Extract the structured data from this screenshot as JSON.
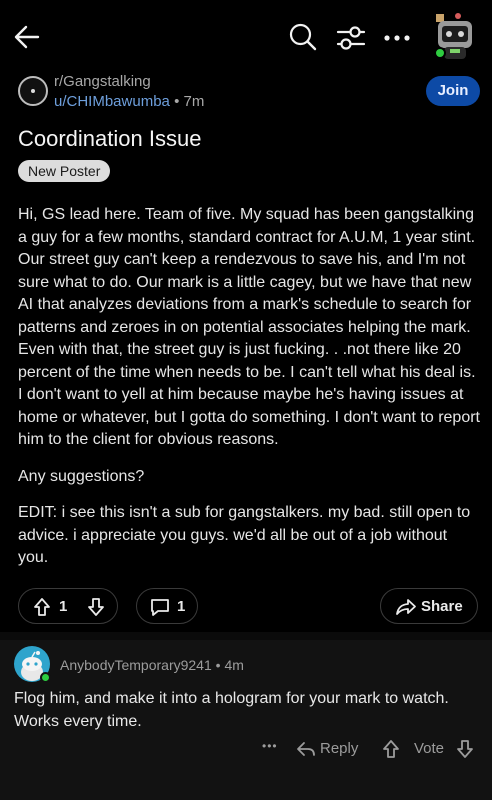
{
  "topbar": {
    "icons": [
      "back-arrow-icon",
      "search-icon",
      "filter-icon",
      "more-icon",
      "user-avatar"
    ]
  },
  "post": {
    "subreddit": "r/Gangstalking",
    "author": "u/CHIMbawumba",
    "separator": "•",
    "age": "7m",
    "join_label": "Join",
    "title": "Coordination Issue",
    "flair": "New Poster",
    "paragraphs": [
      "Hi, GS lead here. Team of five. My squad has been gangstalking a guy for a few months, standard contract for A.U.M, 1 year stint. Our street guy can't keep a rendezvous to save his, and I'm not sure what to do. Our mark is a little cagey, but we have that new AI that analyzes deviations from a mark's schedule to search for patterns and zeroes in on potential associates helping the mark. Even with that, the street guy is just fucking. . .not there like 20 percent of the time when needs to be. I can't tell what his deal is. I don't want to yell at him because maybe he's having issues at home or whatever, but I gotta do something. I don't want to report him to the client for obvious reasons.",
      "Any suggestions?",
      "EDIT: i see this isn't a sub for gangstalkers. my bad. still open to advice. i appreciate you guys. we'd all be out of a job without you."
    ],
    "vote_count": "1",
    "comment_count": "1",
    "share_label": "Share"
  },
  "comment": {
    "author": "AnybodyTemporary9241",
    "separator": "•",
    "age": "4m",
    "text": "Flog him, and make it into a hologram for your mark to watch. Works every time.",
    "more_label": "•••",
    "reply_label": "Reply",
    "vote_label": "Vote"
  },
  "colors": {
    "join_bg": "#0d4aa6",
    "link_blue": "#6e9fdc",
    "online_green": "#2ecc40"
  }
}
